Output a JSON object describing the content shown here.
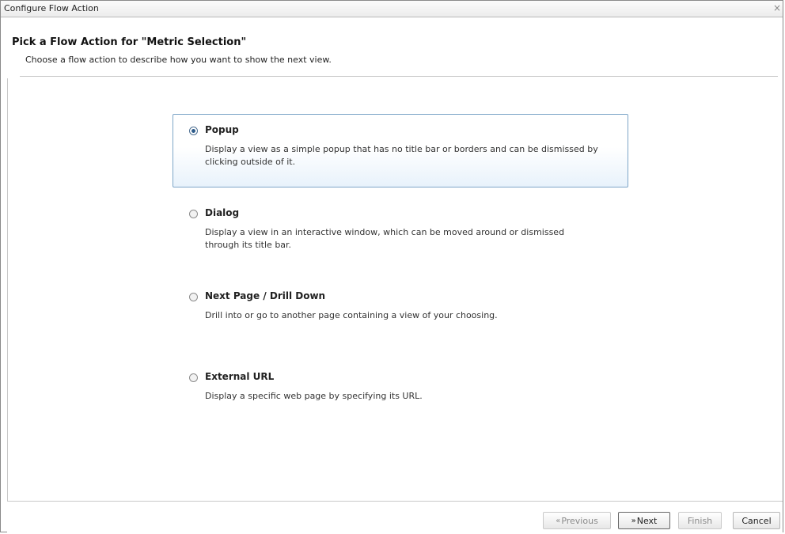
{
  "window": {
    "title": "Configure Flow Action",
    "close_glyph": "×"
  },
  "header": {
    "heading": "Pick a Flow Action for \"Metric Selection\"",
    "subheading": "Choose a flow action to describe how you want to show the next view."
  },
  "options": [
    {
      "label": "Popup",
      "description": "Display a view as a simple popup that has no title bar or borders and can be dismissed by clicking outside of it.",
      "selected": true
    },
    {
      "label": "Dialog",
      "description": "Display a view in an interactive window, which can be moved around or dismissed through its title bar.",
      "selected": false
    },
    {
      "label": "Next Page / Drill Down",
      "description": "Drill into or go to another page containing a view of your choosing.",
      "selected": false
    },
    {
      "label": "External URL",
      "description": "Display a specific web page by specifying its URL.",
      "selected": false
    }
  ],
  "footer": {
    "previous_arrow": "«",
    "previous_label": "Previous",
    "next_arrow": "»",
    "next_label": "Next",
    "finish_label": "Finish",
    "cancel_label": "Cancel"
  },
  "colors": {
    "selected_border": "#7ea6c8",
    "selected_fill": "#e8f2fb"
  }
}
